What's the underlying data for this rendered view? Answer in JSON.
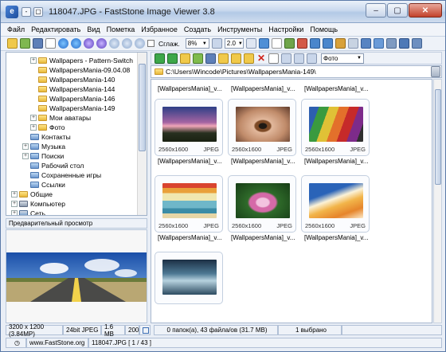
{
  "window": {
    "title": "118047.JPG - FastStone Image Viewer 3.8"
  },
  "menu": [
    "Файл",
    "Редактировать",
    "Вид",
    "Пометка",
    "Избранное",
    "Создать",
    "Инструменты",
    "Настройки",
    "Помощь"
  ],
  "toolbar": {
    "smooth_label": "Сглаж.",
    "zoom_value": "8%",
    "ratio_value": "2.0"
  },
  "tree": {
    "items": [
      {
        "label": "Wallpapers - Pattern-Switch",
        "expander": "+"
      },
      {
        "label": "WallpapersMania-09.04.08",
        "expander": ""
      },
      {
        "label": "WallpapersMania-140",
        "expander": ""
      },
      {
        "label": "WallpapersMania-144",
        "expander": ""
      },
      {
        "label": "WallpapersMania-146",
        "expander": ""
      },
      {
        "label": "WallpapersMania-149",
        "expander": ""
      },
      {
        "label": "Мои аватары",
        "expander": "+"
      },
      {
        "label": "Фото",
        "expander": "+"
      },
      {
        "label": "Контакты",
        "expander": ""
      },
      {
        "label": "Музыка",
        "expander": "+"
      },
      {
        "label": "Поиски",
        "expander": "+"
      },
      {
        "label": "Рабочий стол",
        "expander": ""
      },
      {
        "label": "Сохраненные игры",
        "expander": ""
      },
      {
        "label": "Ссылки",
        "expander": ""
      },
      {
        "label": "Общие",
        "expander": "+"
      },
      {
        "label": "Компьютер",
        "expander": "+"
      },
      {
        "label": "Сеть",
        "expander": "+"
      }
    ]
  },
  "preview": {
    "header": "Предварительный просмотр"
  },
  "browser": {
    "filter_value": "Фото",
    "path": "C:\\Users\\Wincode\\Pictures\\WallpapersMania-149\\",
    "top_labels": [
      "[WallpapersMania]_v...",
      "[WallpapersMania]_v...",
      "[WallpapersMania]_v..."
    ],
    "thumbs": [
      {
        "name": "[WallpapersMania]_v...",
        "size": "2560x1600",
        "type": "JPEG"
      },
      {
        "name": "[WallpapersMania]_v...",
        "size": "2560x1600",
        "type": "JPEG"
      },
      {
        "name": "[WallpapersMania]_v...",
        "size": "2560x1600",
        "type": "JPEG"
      },
      {
        "name": "[WallpapersMania]_v...",
        "size": "2560x1600",
        "type": "JPEG"
      },
      {
        "name": "[WallpapersMania]_v...",
        "size": "2560x1600",
        "type": "JPEG"
      },
      {
        "name": "[WallpapersMania]_v...",
        "size": "2560x1600",
        "type": "JPEG"
      },
      {
        "name": "",
        "size": "",
        "type": ""
      }
    ]
  },
  "status": {
    "dimensions": "3200 x 1200 (3.84MP)",
    "depth": "24bit JPEG",
    "filesize": "1.6 MB",
    "date": "200",
    "folder_summary": "0 папок(а), 43 файла/ов (31.7 MB)",
    "selected": "1 выбрано",
    "website": "www.FastStone.org",
    "current_file": "118047.JPG [ 1 / 43 ]"
  }
}
